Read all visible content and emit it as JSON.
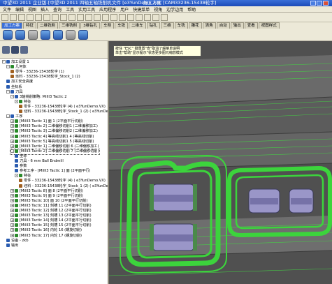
{
  "window": {
    "title_app": "中望3D 2011 企业版-[中望3D 2011 四轴五轴铣削机",
    "title_file": "文件 [e3YunDemo.Z3]",
    "title_plan": "加工方案 [CAM33236-15438轮字]"
  },
  "menu": [
    "文件",
    "编辑",
    "视图",
    "插入",
    "查询",
    "工具",
    "实用工具",
    "应用程序",
    "用户",
    "快捷菜单",
    "视角",
    "边学边用",
    "帮助"
  ],
  "tabs": [
    "加工方案",
    "特征",
    "二维铣削",
    "三维铣削",
    "3维钻孔",
    "车削",
    "车铣",
    "二维车",
    "钻孔",
    "三维",
    "车铣",
    "雕花",
    "清角",
    "自动",
    "输出",
    "查看",
    "视图样式"
  ],
  "tip": {
    "line1": "按住 \"ESC\" 键重置\"查\"取消了解菜单说明",
    "line2": "单击\"帮助\"显示提示\"状态更多图元缩放模式"
  },
  "tree": [
    {
      "d": 0,
      "ex": "-",
      "t": "加工设置 1",
      "c": "#2a5cb0"
    },
    {
      "d": 1,
      "ex": "-",
      "t": "几何体",
      "c": "#2a8a2a"
    },
    {
      "d": 2,
      "ex": "",
      "t": "零件 - 33236-15438轮字 (1)",
      "c": "#a06020"
    },
    {
      "d": 2,
      "ex": "",
      "t": "坯料 - 33236-15438轮字_Stock_1 (2)",
      "c": "#a06020"
    },
    {
      "d": 1,
      "ex": "",
      "t": "加工安全高度",
      "c": "#2a5cb0"
    },
    {
      "d": 1,
      "ex": "",
      "t": "坐标系",
      "c": "#2a5cb0"
    },
    {
      "d": 1,
      "ex": "-",
      "t": "刀具",
      "c": "#2a5cb0"
    },
    {
      "d": 2,
      "ex": "-",
      "t": "3轴铣削策略: MillI3 Tactic 2",
      "c": "#2a5cb0"
    },
    {
      "d": 3,
      "ex": "-",
      "t": "特征",
      "c": "#2a8a2a"
    },
    {
      "d": 4,
      "ex": "",
      "t": "零件 - 33236-15438轮字 (4) ( e3YunDemo.VX)",
      "c": "#a06020"
    },
    {
      "d": 4,
      "ex": "",
      "t": "坯料 - 33236-15438轮字_Stock_1 (2) ( e3YunDe",
      "c": "#a06020"
    },
    {
      "d": 1,
      "ex": "-",
      "t": "工序",
      "c": "#2a5cb0"
    },
    {
      "d": 2,
      "ex": "+",
      "t": "[MillI3 Tactic 1] 面 1 (2平面平行切削)",
      "c": "#2a8a2a"
    },
    {
      "d": 2,
      "ex": "+",
      "t": "[MillI3 Tactic 2] 二维偏移切削1 (二维偏移加工)",
      "c": "#2a8a2a"
    },
    {
      "d": 2,
      "ex": "+",
      "t": "[MillI3 Tactic 3] 二维偏移切削2 (二维偏移加工)",
      "c": "#2a8a2a"
    },
    {
      "d": 2,
      "ex": "+",
      "t": "[MillI3 Tactic 4] 等高线切削1 4 (等高线切削)",
      "c": "#2a8a2a"
    },
    {
      "d": 2,
      "ex": "+",
      "t": "[MillI3 Tactic 5] 等高线切削1 5 (等高线切削)",
      "c": "#2a8a2a"
    },
    {
      "d": 2,
      "ex": "+",
      "t": "[MillI3 Tactic 1] 二维偏移切削 6 (二维偏移加工)",
      "c": "#2a8a2a"
    },
    {
      "d": 2,
      "ex": "-",
      "t": "[MillI3 Tactic 2] 三维偏移切削 7 (三维偏移切削)",
      "c": "#2a8a2a",
      "sel": true
    },
    {
      "d": 3,
      "ex": "",
      "t": "坐标",
      "c": "#2a5cb0"
    },
    {
      "d": 3,
      "ex": "",
      "t": "刀具 - 6 mm Ball Endmill",
      "c": "#2a5cb0"
    },
    {
      "d": 3,
      "ex": "",
      "t": "参数",
      "c": "#2a5cb0"
    },
    {
      "d": 3,
      "ex": "",
      "t": "参考工序 - [MillI3 Tactic 1] 面 (2平面平行)",
      "c": "#2a5cb0"
    },
    {
      "d": 3,
      "ex": "-",
      "t": "特征",
      "c": "#2a8a2a"
    },
    {
      "d": 4,
      "ex": "",
      "t": "零件 - 33236-15438轮字 (4) ( e3YunDemo.VX)",
      "c": "#a06020"
    },
    {
      "d": 4,
      "ex": "",
      "t": "坯料 - 33236-15438轮字_Stock_1 (2) ( e3YunDe",
      "c": "#a06020"
    },
    {
      "d": 2,
      "ex": "+",
      "t": "[MillI3 Tactic 8] 面 8 (2平面平行切削)",
      "c": "#2a8a2a"
    },
    {
      "d": 2,
      "ex": "+",
      "t": "[MillI3 Tactic 9] 面 9 (2平面平行切削)",
      "c": "#2a8a2a"
    },
    {
      "d": 2,
      "ex": "+",
      "t": "[MillI3 Tactic 10] 面 10 (2平面平行切削)",
      "c": "#2a8a2a"
    },
    {
      "d": 2,
      "ex": "+",
      "t": "[MillI3 Tactic 11] 刻槽 11 (2平面平行切削)",
      "c": "#2a8a2a"
    },
    {
      "d": 2,
      "ex": "+",
      "t": "[MillI3 Tactic 12] 刻槽 12 (2平面平行切削)",
      "c": "#2a8a2a"
    },
    {
      "d": 2,
      "ex": "+",
      "t": "[MillI3 Tactic 13] 刻槽 13 (2平面平行切削)",
      "c": "#2a8a2a"
    },
    {
      "d": 2,
      "ex": "+",
      "t": "[MillI3 Tactic 14] 刻槽 14 (2平面平行切削)",
      "c": "#2a8a2a"
    },
    {
      "d": 2,
      "ex": "+",
      "t": "[MillI3 Tactic 15] 刻槽 15 (2平面平行切削)",
      "c": "#2a8a2a"
    },
    {
      "d": 2,
      "ex": "+",
      "t": "[MillI3 Tactic 16] 内轮 16 (螺旋切削)",
      "c": "#2a8a2a"
    },
    {
      "d": 2,
      "ex": "+",
      "t": "[MillI3 Tactic 17] 内轮 17 (螺旋切削)",
      "c": "#2a8a2a"
    },
    {
      "d": 1,
      "ex": "",
      "t": "设备 - zkb",
      "c": "#2a5cb0"
    },
    {
      "d": 1,
      "ex": "",
      "t": "输出",
      "c": "#2a5cb0"
    }
  ]
}
